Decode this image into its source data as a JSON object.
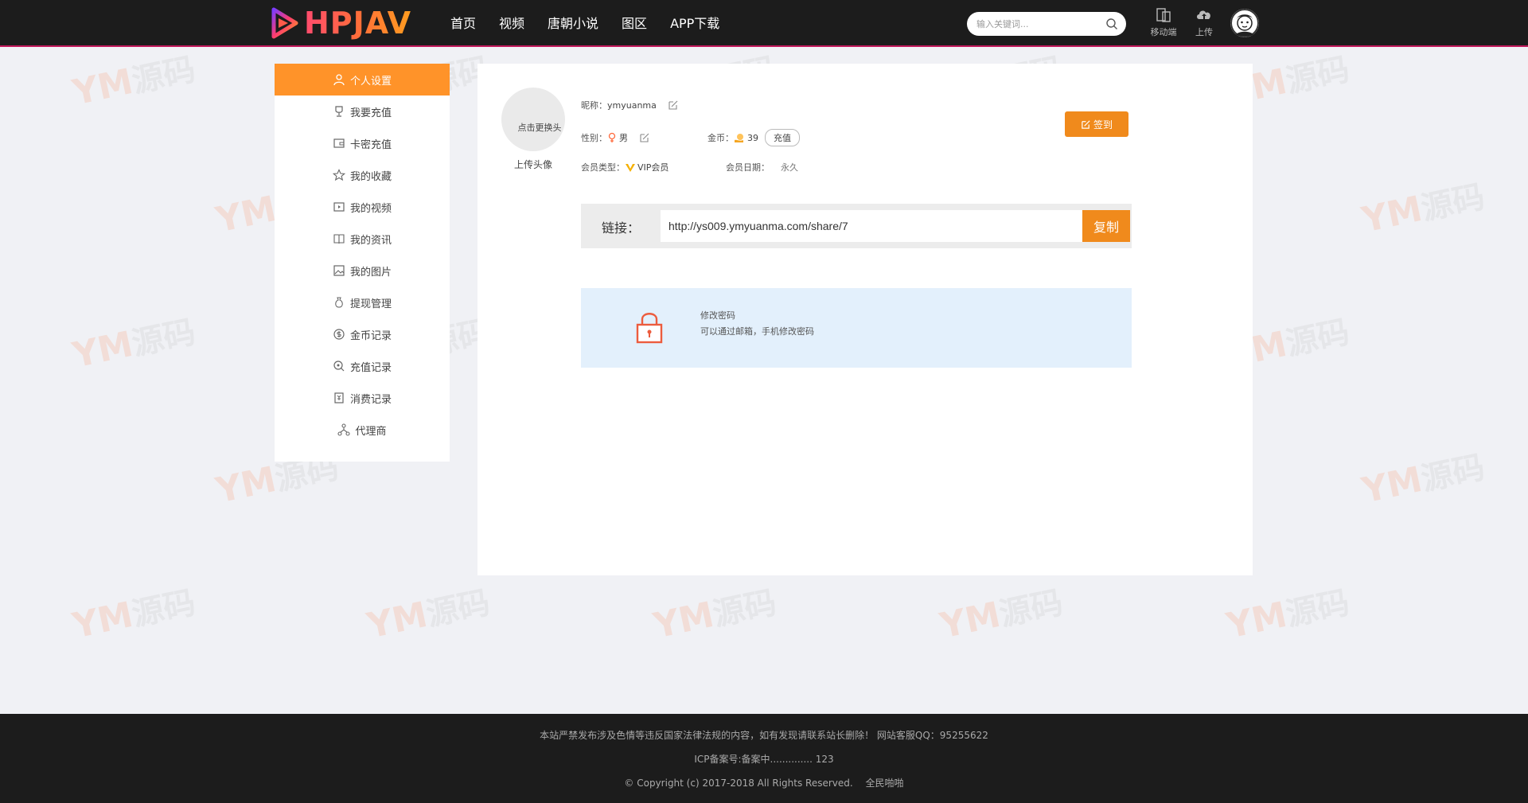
{
  "header": {
    "logo_text": "HPJAV",
    "nav": [
      "首页",
      "视频",
      "唐朝小说",
      "图区",
      "APP下载"
    ],
    "search_placeholder": "输入关键词...",
    "mobile_label": "移动端",
    "upload_label": "上传"
  },
  "sidebar": {
    "items": [
      {
        "label": "个人设置",
        "icon": "user-icon",
        "active": true
      },
      {
        "label": "我要充值",
        "icon": "trophy-icon"
      },
      {
        "label": "卡密充值",
        "icon": "wallet-icon"
      },
      {
        "label": "我的收藏",
        "icon": "star-icon"
      },
      {
        "label": "我的视频",
        "icon": "video-icon"
      },
      {
        "label": "我的资讯",
        "icon": "book-icon"
      },
      {
        "label": "我的图片",
        "icon": "image-icon"
      },
      {
        "label": "提现管理",
        "icon": "money-bag-icon"
      },
      {
        "label": "金币记录",
        "icon": "coin-icon"
      },
      {
        "label": "充值记录",
        "icon": "search-coin-icon"
      },
      {
        "label": "消费记录",
        "icon": "receipt-icon"
      },
      {
        "label": "代理商",
        "icon": "network-icon"
      }
    ]
  },
  "profile": {
    "avatar_alt": "点击更换头",
    "upload_avatar": "上传头像",
    "nickname_label": "昵称：",
    "nickname": "ymyuanma",
    "gender_label": "性别：",
    "gender": "男",
    "coins_label": "金币：",
    "coins": "39",
    "recharge_button": "充值",
    "member_type_label": "会员类型：",
    "member_type": "VIP会员",
    "member_date_label": "会员日期：",
    "member_date": "永久",
    "signin_button": "签到"
  },
  "share": {
    "label": "链接：",
    "url": "http://ys009.ymyuanma.com/share/7",
    "copy_button": "复制"
  },
  "password": {
    "title": "修改密码",
    "desc": "可以通过邮箱，手机修改密码"
  },
  "footer": {
    "notice": "本站严禁发布涉及色情等违反国家法律法规的内容，如有发现请联系站长删除！ 网站客服QQ：95255622",
    "icp": "ICP备案号:备案中..............      123",
    "copyright": "© Copyright (c) 2017-2018 All Rights Reserved.",
    "badge_alt": "全民啪啪"
  },
  "colors": {
    "accent": "#f08a1c",
    "sidebar_active": "#ff9329",
    "header_bg": "#1c1c1c",
    "header_border": "#c2185b",
    "pwd_box_bg": "#e3f0fc"
  }
}
